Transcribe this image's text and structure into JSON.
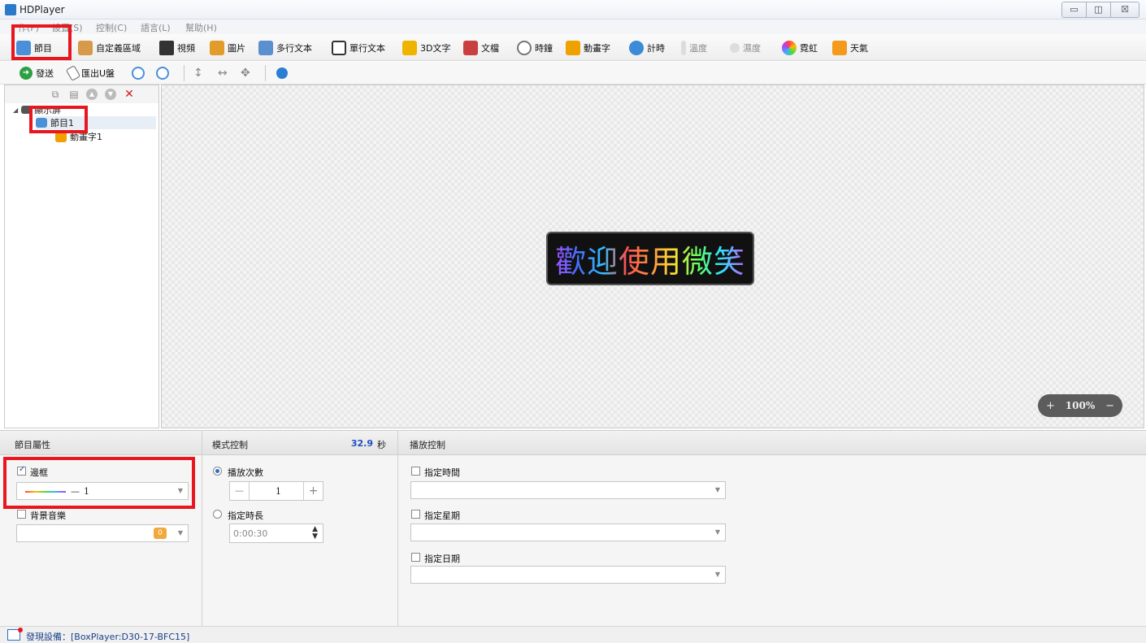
{
  "window": {
    "title": "HDPlayer",
    "controls": {
      "minimize": "▭",
      "maximize": "◫",
      "close": "☒"
    }
  },
  "menu": {
    "items": [
      "作(F)",
      "設置(S)",
      "控制(C)",
      "語言(L)",
      "幫助(H)"
    ]
  },
  "toolbar1": {
    "items": [
      {
        "label": "節目",
        "icon": "program-icon",
        "color": "#4a90d9"
      },
      {
        "label": "自定義區域",
        "icon": "custom-area-icon",
        "color": "#d69a4a"
      },
      {
        "label": "視頻",
        "icon": "video-icon",
        "color": "#333333"
      },
      {
        "label": "圖片",
        "icon": "picture-icon",
        "color": "#e39b2a"
      },
      {
        "label": "多行文本",
        "icon": "multiline-text-icon",
        "color": "#5a8fd0"
      },
      {
        "label": "單行文本",
        "icon": "single-line-text-icon",
        "color": "#333333"
      },
      {
        "label": "3D文字",
        "icon": "3d-text-icon",
        "color": "#f0b400"
      },
      {
        "label": "文檔",
        "icon": "document-icon",
        "color": "#c94040"
      },
      {
        "label": "時鐘",
        "icon": "clock-icon",
        "color": "#888888"
      },
      {
        "label": "動畫字",
        "icon": "animated-text-icon",
        "color": "#f0a000"
      },
      {
        "label": "計時",
        "icon": "timer-icon",
        "color": "#3b8bd6"
      },
      {
        "label": "溫度",
        "icon": "thermometer-icon",
        "color": "#bbbbbb"
      },
      {
        "label": "濕度",
        "icon": "humidity-icon",
        "color": "#bbbbbb"
      },
      {
        "label": "霓虹",
        "icon": "neon-icon",
        "color": "#e04090"
      },
      {
        "label": "天氣",
        "icon": "weather-icon",
        "color": "#f59a1c"
      }
    ]
  },
  "toolbar2": {
    "send": "發送",
    "export_usb": "匯出U盤"
  },
  "tree": {
    "root": "顯示屏",
    "program": "節目1",
    "child": "動畫字1"
  },
  "canvas": {
    "led_text": "歡迎使用微笑",
    "zoom": "100%",
    "zoom_in": "+",
    "zoom_out": "−"
  },
  "properties": {
    "program_props": {
      "header": "節目屬性",
      "border_label": "邊框",
      "border_checked": true,
      "border_value": "1",
      "bg_music_label": "背景音樂",
      "bg_music_checked": false,
      "bg_music_badge": "0"
    },
    "mode_control": {
      "header": "模式控制",
      "duration_value": "32.9",
      "duration_unit": "秒",
      "play_count_label": "播放次數",
      "play_count_value": "1",
      "play_count_minus": "—",
      "play_count_plus": "+",
      "duration_label": "指定時長",
      "duration_input": "0:00:30"
    },
    "play_control": {
      "header": "播放控制",
      "time_label": "指定時間",
      "week_label": "指定星期",
      "date_label": "指定日期"
    }
  },
  "status": {
    "text": "發現設備：[BoxPlayer:D30-17-BFC15]"
  }
}
